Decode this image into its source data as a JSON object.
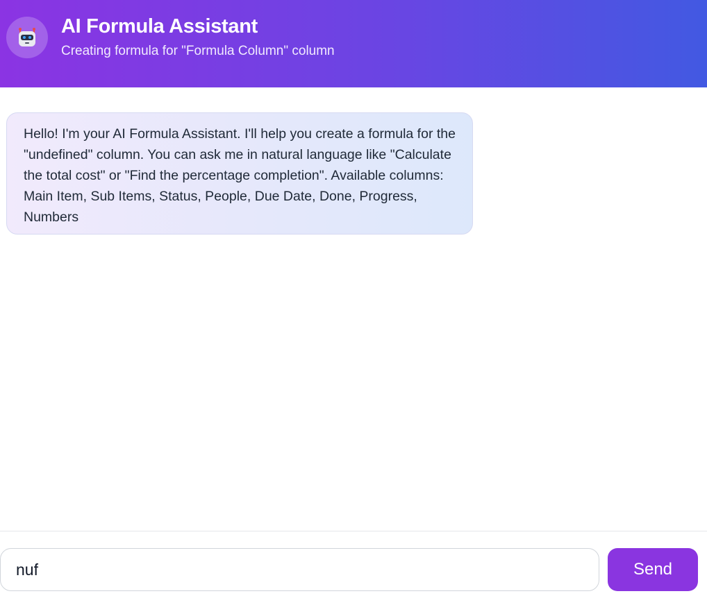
{
  "header": {
    "icon": "robot-icon",
    "title": "AI Formula Assistant",
    "subtitle": "Creating formula for \"Formula Column\" column"
  },
  "messages": [
    {
      "role": "assistant",
      "text": "Hello! I'm your AI Formula Assistant. I'll help you create a formula for the \"undefined\" column. You can ask me in natural language like \"Calculate the total cost\" or \"Find the percentage completion\". Available columns: Main Item, Sub Items, Status, People, Due Date, Done, Progress, Numbers"
    }
  ],
  "composer": {
    "value": "nuf",
    "send_label": "Send"
  },
  "colors": {
    "header_gradient_start": "#8b34e3",
    "header_gradient_end": "#4259e2",
    "send_button": "#8a35e0"
  }
}
